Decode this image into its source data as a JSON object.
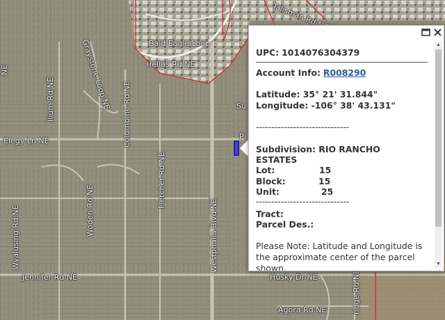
{
  "map": {
    "streets": [
      {
        "key": "graystone",
        "label": "Graystone Loop NE"
      },
      {
        "key": "ilium",
        "label": "Ilium Rd NE"
      },
      {
        "key": "columbine",
        "label": "Columbine Rd NE"
      },
      {
        "key": "elegy",
        "label": "Elegy Ln NE"
      },
      {
        "key": "fletcher",
        "label": "Fletcher Rd NE"
      },
      {
        "key": "wyalusing",
        "label": "Wyalusing Rd NE"
      },
      {
        "key": "woden",
        "label": "Woden Rd NE"
      },
      {
        "key": "westphalia",
        "label": "Westphalia Blvd NE"
      },
      {
        "key": "jennifer",
        "label": "Jennifer Rd NE"
      },
      {
        "key": "husky",
        "label": "Husky Dr NE"
      },
      {
        "key": "agora",
        "label": "Agora Rd NE"
      },
      {
        "key": "bald_eagle",
        "label": "Bald Eagle Loop"
      },
      {
        "key": "hellas",
        "label": "Hellas Rd NE"
      },
      {
        "key": "talisman",
        "label": "Talisman Rd NE"
      },
      {
        "key": "partial_su",
        "label": "Su"
      },
      {
        "key": "partial_p",
        "label": "P"
      },
      {
        "key": "partial_ne",
        "label": "NE"
      },
      {
        "key": "partial_bridge",
        "label": "ridge Rd NE"
      }
    ],
    "parcel_color": "#3b3bd8",
    "boundary_color": "#d62828"
  },
  "popup": {
    "upc_label": "UPC:",
    "upc_value": "1014076304379",
    "account_label": "Account Info:",
    "account_value": "R008290",
    "latitude_line": "Latitude: 35° 21' 31.844\"",
    "longitude_line": "Longitude: -106° 38' 43.131\"",
    "dashes": "------------------------------",
    "subdivision_label": "Subdivision:",
    "subdivision_value_1": "RIO RANCHO",
    "subdivision_value_2": "ESTATES",
    "lot_label": "Lot:",
    "lot_value": "15",
    "block_label": "Block:",
    "block_value": "15",
    "unit_label": "Unit:",
    "unit_value": "25",
    "tract_label": "Tract:",
    "parcel_des_label": "Parcel Des.:",
    "note_1": "Please Note: Latitude and Longitude is",
    "note_2": "the approximate center of the parcel",
    "note_3": "shown."
  }
}
